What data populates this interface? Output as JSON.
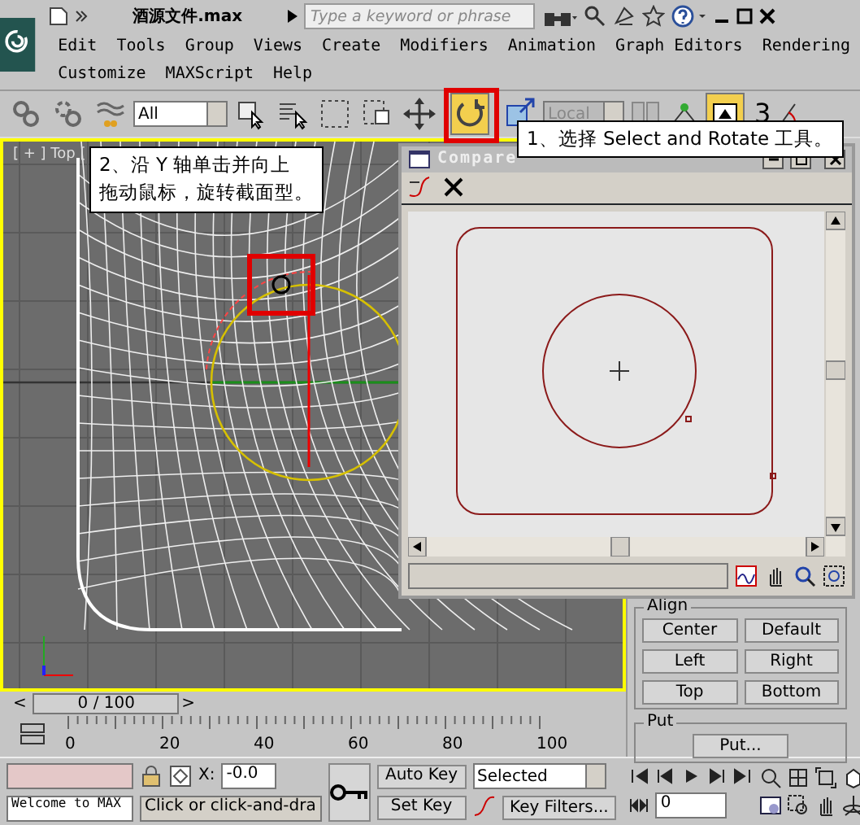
{
  "title_bar": {
    "file_name": "酒源文件.max",
    "search": {
      "placeholder": "Type a keyword or phrase"
    }
  },
  "menu": [
    [
      "Edit",
      "Tools",
      "Group",
      "Views",
      "Create",
      "Modifiers",
      "Animation",
      "Graph Editors",
      "Rendering"
    ],
    [
      "Customize",
      "MAXScript",
      "Help"
    ]
  ],
  "toolbar": {
    "selection_filter": "All",
    "coordinate_system": {
      "value": "Local",
      "disabled": true
    },
    "snap_label": "3",
    "tools": [
      {
        "kind": "link"
      },
      {
        "kind": "unlink"
      },
      {
        "kind": "bind"
      },
      {
        "kind": "filter"
      },
      {
        "kind": "select"
      },
      {
        "kind": "select-by-name"
      },
      {
        "kind": "region"
      },
      {
        "kind": "window"
      },
      {
        "kind": "move"
      },
      {
        "kind": "rotate",
        "selected": true
      },
      {
        "kind": "scale"
      }
    ]
  },
  "viewport": {
    "label": "[ + ] Top ["
  },
  "callouts": [
    {
      "lines": [
        "1、选择 Select and Rotate 工具。"
      ]
    },
    {
      "lines": [
        "2、沿 Y 轴单击并向上",
        "拖动鼠标，旋转截面型。"
      ]
    }
  ],
  "compare_window": {
    "title": "Compare"
  },
  "command_panel": {
    "align": {
      "title": "Align",
      "buttons": [
        "Center",
        "Default",
        "Left",
        "Right",
        "Top",
        "Bottom"
      ]
    },
    "put": {
      "title": "Put",
      "button": "Put..."
    }
  },
  "time_slider": {
    "prev": "<",
    "frame": "0 / 100",
    "next": ">",
    "level": 0
  },
  "track_ticks": [
    "0",
    "20",
    "40",
    "60",
    "80",
    "100"
  ],
  "status": {
    "maxscript": "Welcome to MAX",
    "x_label": "X:",
    "x_value": "-0.0",
    "prompt": "Click or click-and-dra",
    "auto_key": "Auto Key",
    "set_key": "Set Key",
    "key_mode": "Selected",
    "key_filters": "Key Filters...",
    "frame": "0"
  }
}
